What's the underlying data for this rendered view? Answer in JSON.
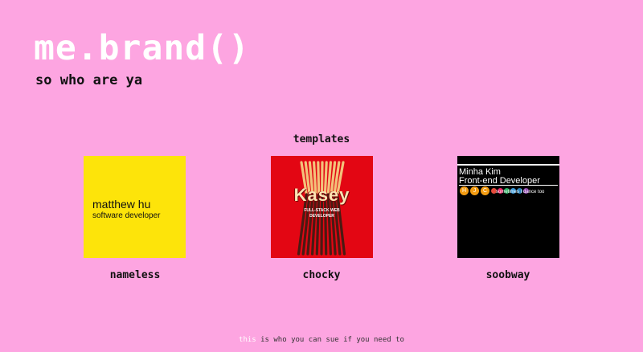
{
  "header": {
    "title": "me.brand()",
    "subtitle": "so who are ya"
  },
  "templates": {
    "heading": "templates",
    "cards": [
      {
        "label": "nameless",
        "preview": {
          "name": "matthew hu",
          "role": "software developer",
          "background": "#fde40a"
        }
      },
      {
        "label": "chocky",
        "preview": {
          "name": "Kasey",
          "role": "FULL-STACK WEB DEVELOPER",
          "background": "#e30613"
        }
      },
      {
        "label": "soobway",
        "preview": {
          "name": "Minha Kim",
          "role": "Front-end Developer",
          "tagline": "sometimes I dance too",
          "background": "#000000",
          "badges": [
            {
              "glyph": "H",
              "color": "#f39c12"
            },
            {
              "glyph": "J",
              "color": "#f39c12"
            },
            {
              "glyph": "C",
              "color": "#f39c12"
            },
            {
              "glyph": "",
              "color": "#e74c3c"
            },
            {
              "glyph": "",
              "color": "#e91e63"
            },
            {
              "glyph": "",
              "color": "#27ae60"
            },
            {
              "glyph": "",
              "color": "#3498db"
            },
            {
              "glyph": "",
              "color": "#2980b9"
            },
            {
              "glyph": "",
              "color": "#8e44ad"
            }
          ]
        }
      }
    ]
  },
  "footer": {
    "link_text": "this",
    "text": " is who you can sue if you need to"
  },
  "colors": {
    "background": "#fda5e1",
    "title": "#ffffff"
  }
}
